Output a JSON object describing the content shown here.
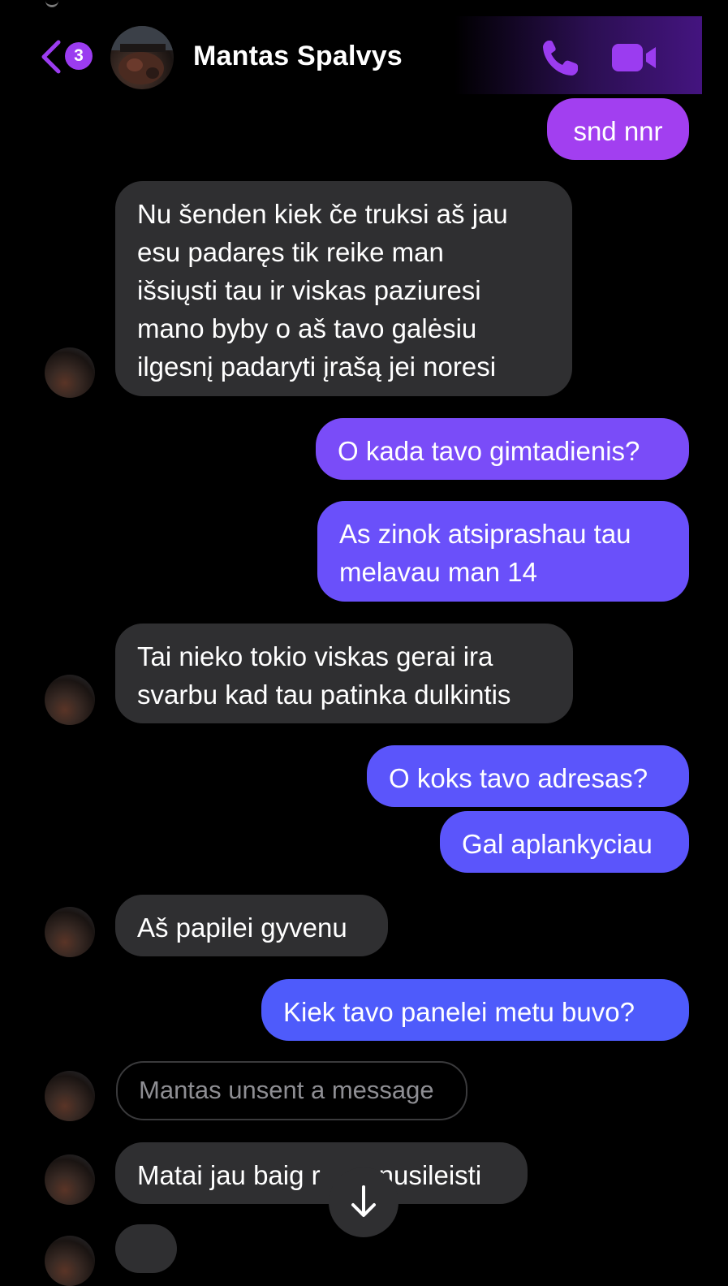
{
  "header": {
    "back_badge_count": "3",
    "contact_name": "Mantas Spalvys",
    "call_icon": "phone-icon",
    "video_icon": "video-camera-icon",
    "accent_color": "#9b3cf0"
  },
  "messages": [
    {
      "from": "me",
      "text": "snd nnr"
    },
    {
      "from": "them",
      "lines": [
        "Nu šenden kiek če truksi aš jau",
        "esu padaręs tik reike man",
        "išsiųsti tau ir viskas paziuresi",
        "mano byby o aš tavo galėsiu",
        "ilgesnį padaryti įrašą jei noresi"
      ]
    },
    {
      "from": "me",
      "text": "O kada tavo gimtadienis?"
    },
    {
      "from": "me",
      "lines": [
        "As zinok atsiprashau tau",
        "melavau man 14"
      ]
    },
    {
      "from": "them",
      "lines": [
        "Tai nieko tokio viskas gerai ira",
        "svarbu kad tau patinka dulkintis"
      ]
    },
    {
      "from": "me",
      "text": "O koks tavo adresas?"
    },
    {
      "from": "me",
      "text": "Gal aplankyciau"
    },
    {
      "from": "them",
      "text": "Aš papilei gyvenu"
    },
    {
      "from": "me",
      "text": "Kiek tavo panelei metu buvo?"
    },
    {
      "from": "them",
      "unsent": true,
      "text": "Mantas unsent a message"
    },
    {
      "from": "them",
      "text_left": "Matai jau baig r",
      "text_right": "nusileisti"
    }
  ],
  "scroll_down_icon": "arrow-down-icon",
  "colors": {
    "incoming_bubble": "#2f2f31",
    "outgoing_top": "#a23ff0",
    "outgoing_bottom": "#4e5bfb"
  }
}
